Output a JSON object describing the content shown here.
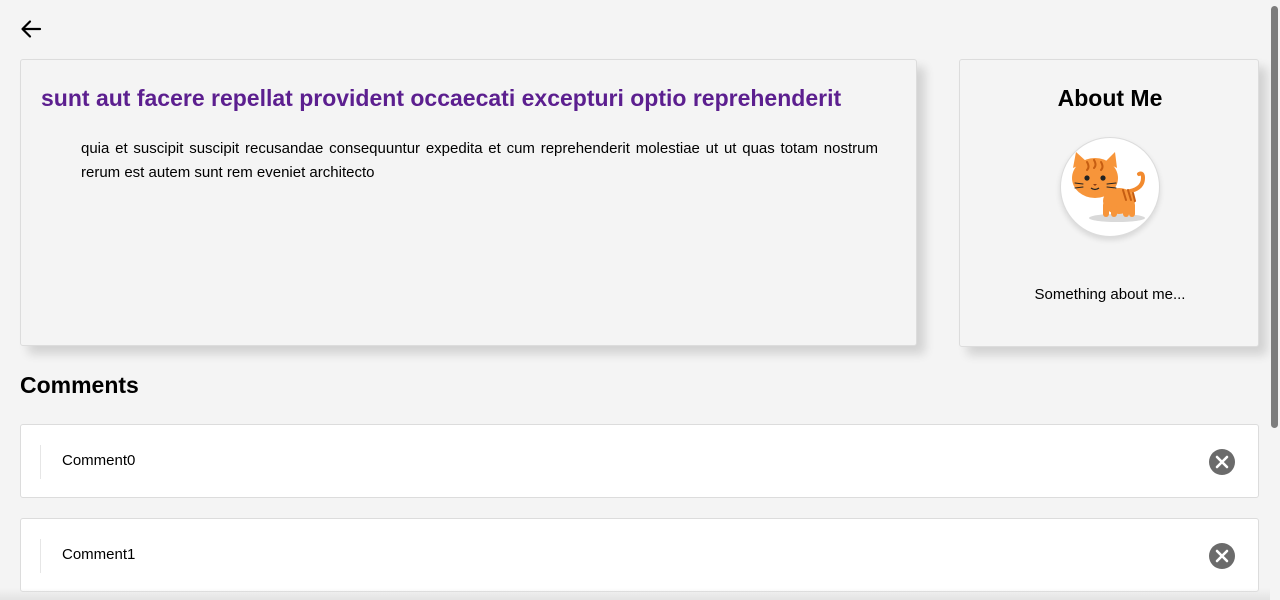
{
  "navigation": {
    "back_icon": "arrow-left-icon"
  },
  "post": {
    "title": "sunt aut facere repellat provident occaecati excepturi optio reprehenderit",
    "body": "quia et suscipit suscipit recusandae consequuntur expedita et cum reprehenderit molestiae ut ut quas totam nostrum rerum est autem sunt rem eveniet architecto",
    "title_color": "#5c1f8f"
  },
  "about": {
    "title": "About Me",
    "avatar_icon": "cat-avatar",
    "text": "Something about me..."
  },
  "comments": {
    "heading": "Comments",
    "delete_icon": "close-circle-icon",
    "items": [
      {
        "text": "Comment0"
      },
      {
        "text": "Comment1"
      }
    ]
  }
}
